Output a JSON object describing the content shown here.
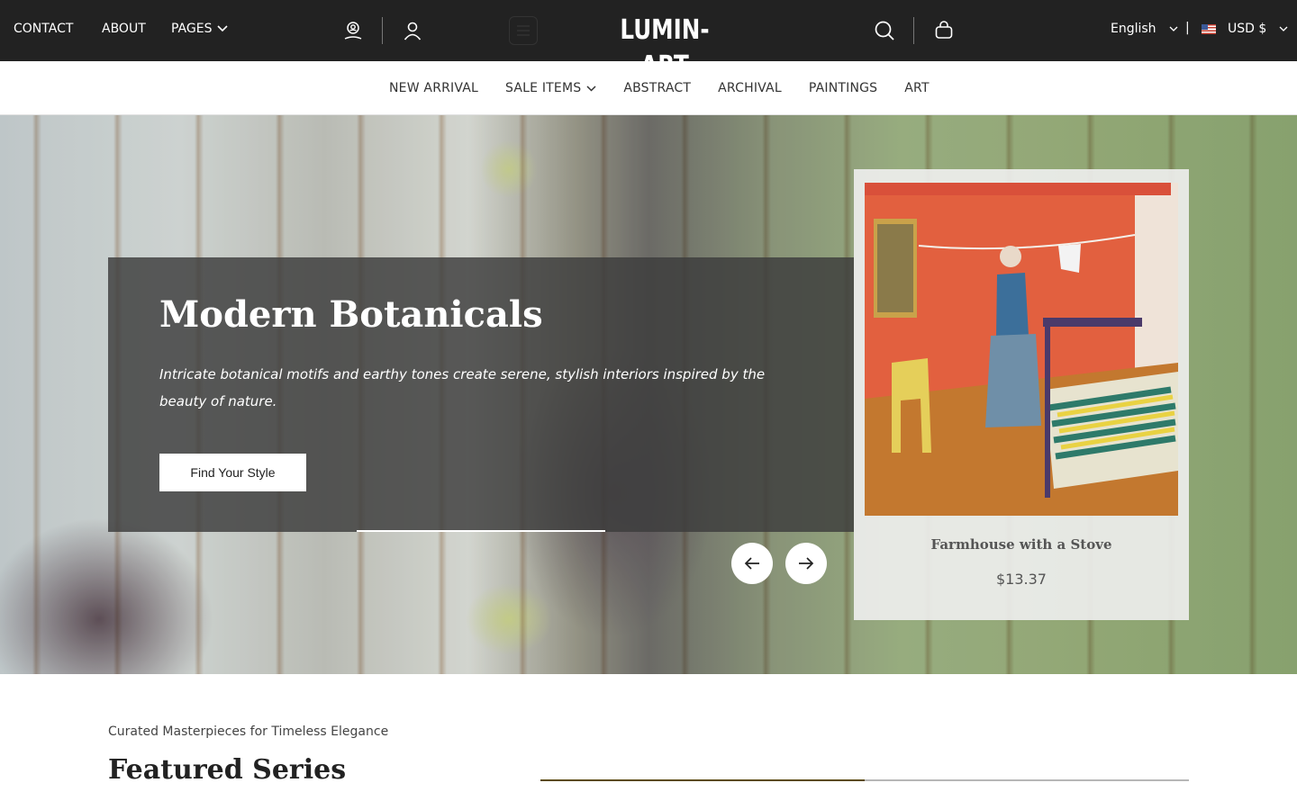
{
  "topbar": {
    "links": {
      "contact": "CONTACT",
      "about": "ABOUT",
      "pages": "PAGES"
    },
    "logo": "LUMIN-ART",
    "language": "English",
    "separator": "|",
    "currency": "USD $",
    "background_color": "#222222"
  },
  "mainnav": {
    "items": [
      {
        "label": "NEW ARRIVAL"
      },
      {
        "label": "SALE ITEMS"
      },
      {
        "label": "ABSTRACT"
      },
      {
        "label": "ARCHIVAL"
      },
      {
        "label": "PAINTINGS"
      },
      {
        "label": "ART"
      }
    ]
  },
  "hero": {
    "title": "Modern Botanicals",
    "text": "Intricate botanical motifs and earthy tones create serene, stylish interiors inspired by the beauty of nature.",
    "cta": "Find Your Style",
    "product": {
      "title": "Farmhouse with a Stove",
      "price": "$13.37"
    }
  },
  "featured": {
    "eyebrow": "Curated Masterpieces for Timeless Elegance",
    "title": "Featured Series",
    "accent_color": "#5b4a10"
  }
}
